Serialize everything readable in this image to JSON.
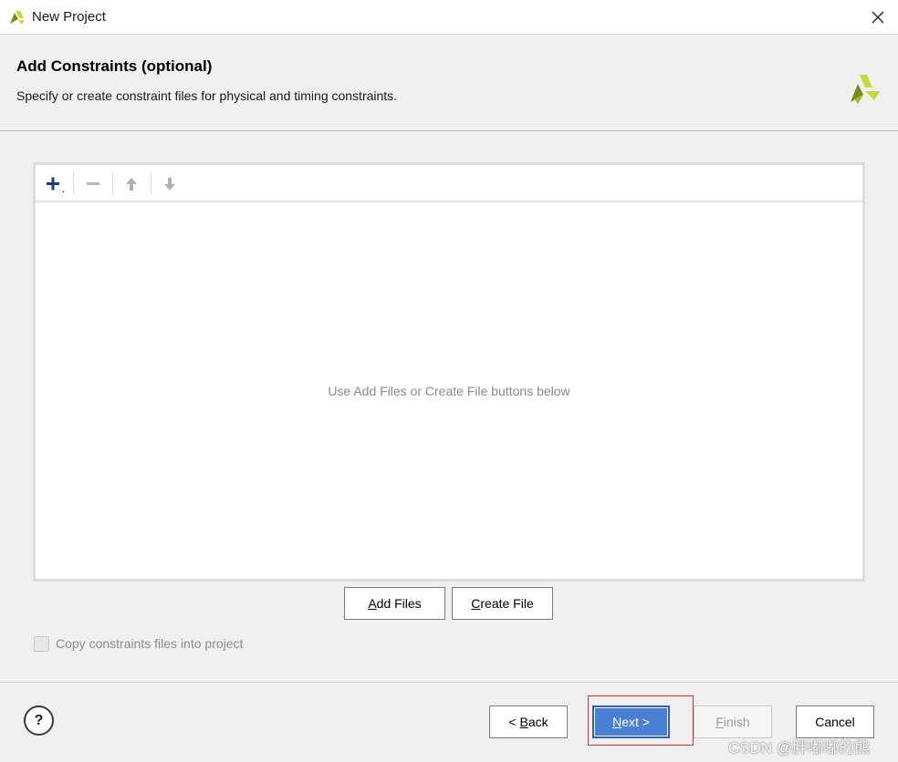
{
  "window": {
    "title": "New Project",
    "close_icon": "close-icon",
    "logo_icon": "vivado-logo-icon"
  },
  "header": {
    "title": "Add Constraints (optional)",
    "subtitle": "Specify or create constraint files for physical and timing constraints."
  },
  "toolbar": {
    "add_icon": "plus-icon",
    "remove_icon": "minus-icon",
    "up_icon": "arrow-up-icon",
    "down_icon": "arrow-down-icon"
  },
  "file_list": {
    "empty_message": "Use Add Files or Create File buttons below"
  },
  "actions": {
    "add_files_accel": "A",
    "add_files_rest": "dd Files",
    "create_file_accel": "C",
    "create_file_rest": "reate File"
  },
  "options": {
    "copy_constraints_label": "Copy constraints files into project",
    "copy_constraints_checked": false,
    "copy_constraints_enabled": false
  },
  "footer": {
    "help_label": "?",
    "back_prefix": "< ",
    "back_accel": "B",
    "back_rest": "ack",
    "next_accel": "N",
    "next_rest": "ext >",
    "finish_accel": "F",
    "finish_rest": "inish",
    "cancel_label": "Cancel"
  },
  "watermark": "CSDN @胖嘟嘟的熊",
  "colors": {
    "primary_button": "#4a7fd6",
    "highlight_outline": "#e03030",
    "logo_green": "#c6d83a",
    "logo_dark": "#7a8a1a"
  }
}
